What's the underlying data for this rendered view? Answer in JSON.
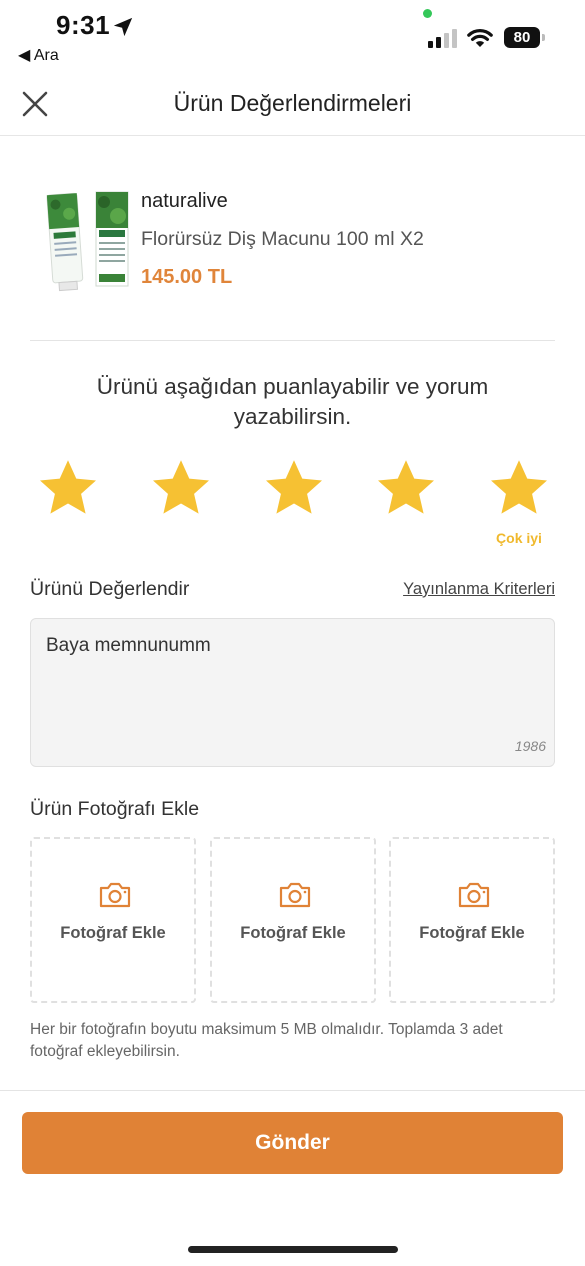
{
  "status_bar": {
    "time": "9:31",
    "back_app": "◀ Ara",
    "battery": "80"
  },
  "nav": {
    "title": "Ürün Değerlendirmeleri",
    "close_icon": "close-icon"
  },
  "product": {
    "brand": "naturalive",
    "name": "Florürsüz Diş Macunu 100 ml X2",
    "price": "145.00 TL"
  },
  "rating": {
    "prompt": "Ürünü aşağıdan puanlayabilir ve yorum yazabilirsin.",
    "stars": 5,
    "max_stars": 5,
    "label": "Çok iyi",
    "star_color": "#f6c133"
  },
  "review": {
    "title": "Ürünü Değerlendir",
    "criteria_link": "Yayınlanma Kriterleri",
    "text": "Baya memnunumm",
    "char_count": "1986"
  },
  "photos": {
    "title": "Ürün Fotoğrafı Ekle",
    "slots": [
      {
        "label": "Fotoğraf Ekle"
      },
      {
        "label": "Fotoğraf Ekle"
      },
      {
        "label": "Fotoğraf Ekle"
      }
    ],
    "note": "Her bir fotoğrafın boyutu maksimum 5 MB olmalıdır. Toplamda 3 adet fotoğraf ekleyebilirsin."
  },
  "submit": {
    "label": "Gönder",
    "color": "#e08236"
  }
}
